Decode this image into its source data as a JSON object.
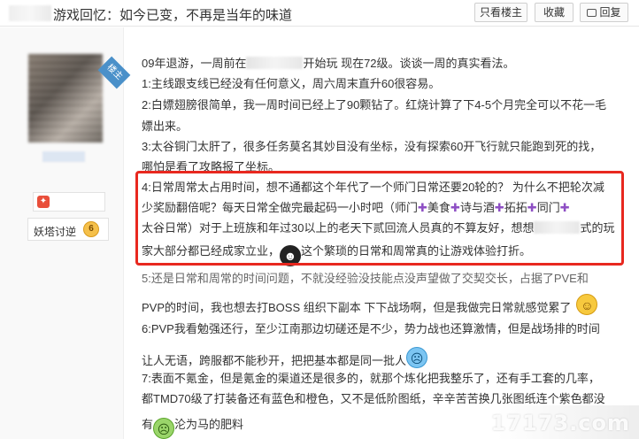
{
  "header": {
    "title": "游戏回忆：如今已变，不再是当年的味道",
    "only_author_label": "只看楼主",
    "favorite_label": "收藏",
    "reply_label": "回复"
  },
  "user": {
    "ribbon_label": "楼主",
    "rank_label": "妖塔讨逆",
    "rank_badge": "6"
  },
  "post": {
    "l1a": "09年退游，一周前在",
    "l1b": "开始玩 现在72级。谈谈一周的真实看法。",
    "l2": "1:主线跟支线已经没有任何意义，周六周末直升60很容易。",
    "l3": "2:白嫖翅膀很简单，我一周时间已经上了90颗钻了。红烧计算了下4-5个月完全可以不花一毛",
    "l4": "嫖出来。",
    "l5": "3:太谷铜门太肝了，很多任务莫名其妙目没有坐标，没有探索60开飞行就只能跑到死的找，",
    "l6": "哪怕是看了攻略报了坐标。",
    "l7": "4:日常周常太占用时间，想不通都这个年代了一个师门日常还要20轮的？ 为什么不把轮次减",
    "l8a": "少奖励翻倍呢？每天日常全做完最起码一小时吧（师门",
    "l8b": "美食",
    "l8c": "诗与酒",
    "l8d": "拓拓",
    "l8e": "同门",
    "l9a": "太谷日常）对于上班族和年过30以上的老天下贰回流人员真的不算友好，想想",
    "l9b": "式的玩",
    "l10a": "家大部分都已经成家立业，",
    "l10b": "这个繁琐的日常和周常真的让游戏体验打折。",
    "l11": "5:还是日常和周常的时间问题，不就没经验没技能点没声望做了交契交长，占据了PVE和",
    "l12": "PVP的时间，我也想去打BOSS 组织下副本 下下战场啊，但是我做完日常就感觉累了",
    "l13": "6:PVP我看勉强还行，至少江南那边切磋还是不少，势力战也还算激情，但是战场排的时间",
    "l14": "让人无语，跨服都不能秒开，把把基本都是同一批人",
    "l15": "7:表面不氪金，但是氪金的渠道还是很多的，就那个炼化把我整乐了，还有手工套的几率，",
    "l16": "都TMD70级了打装备还有蓝色和橙色，又不是低阶图纸，辛辛苦苦换几张图纸连个紫色都没",
    "l17a": "有",
    "l17b": "沦为马的肥料"
  },
  "watermark": "17173.com",
  "colors": {
    "highlight": "#e8281f",
    "plus": "#8e4fc4",
    "ribbon": "#4a90c9"
  }
}
